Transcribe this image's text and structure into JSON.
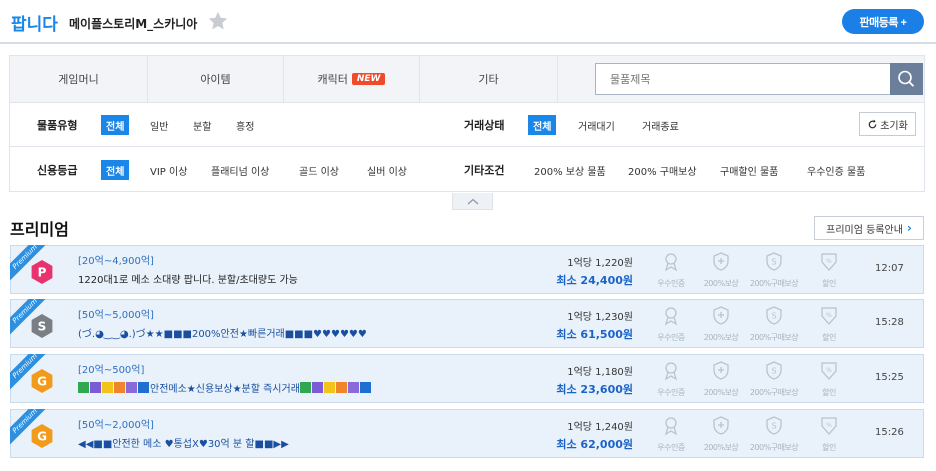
{
  "header": {
    "sell_label": "팝니다",
    "game_name": "메이플스토리M_스카니아",
    "register_button": "판매등록 +"
  },
  "tabs": [
    {
      "label": "게임머니"
    },
    {
      "label": "아이템"
    },
    {
      "label": "캐릭터",
      "badge": "NEW"
    },
    {
      "label": "기타"
    }
  ],
  "search": {
    "placeholder": "물품제목"
  },
  "filters": {
    "product_type": {
      "label": "물품유형",
      "options": [
        "전체",
        "일반",
        "분할",
        "흥정"
      ],
      "selected": "전체"
    },
    "trade_status": {
      "label": "거래상태",
      "options": [
        "전체",
        "거래대기",
        "거래종료"
      ],
      "selected": "전체"
    },
    "reset_label": "초기화",
    "credit": {
      "label": "신용등급",
      "options": [
        "전체",
        "VIP 이상",
        "플래티넘 이상",
        "골드 이상",
        "실버 이상"
      ],
      "selected": "전체"
    },
    "other": {
      "label": "기타조건",
      "options": [
        "200% 보상 물품",
        "200% 구매보상",
        "구매할인 물품",
        "우수인증 물품"
      ]
    }
  },
  "premium": {
    "title": "프리미엄",
    "guide_button": "프리미엄 등록안내",
    "ribbon_label": "Premium",
    "cert_labels": [
      "우수인증",
      "200%보상",
      "200%구매보상",
      "할인"
    ],
    "listings": [
      {
        "grade": "P",
        "grade_color": "#e8336e",
        "range": "[20억~4,900억]",
        "title": "1220대1로 메소 소대량 팝니다. 분할/초대량도 가능",
        "unit_price": "1억당 1,220원",
        "min_price": "최소 24,400원",
        "time": "12:07"
      },
      {
        "grade": "S",
        "grade_color": "#7a7f86",
        "range": "[50억~5,000억]",
        "title": "(づ.◕‿‿◕.)づ★★■■■200%안전★빠른거래■■■♥♥♥♥♥♥",
        "unit_price": "1억당 1,230원",
        "min_price": "최소 61,500원",
        "time": "15:28"
      },
      {
        "grade": "G",
        "grade_color": "#f29a1a",
        "range": "[20억~500억]",
        "title_before": "안전메소★신용보상★분할 즉시거래",
        "unit_price": "1억당 1,180원",
        "min_price": "최소 23,600원",
        "time": "15:25"
      },
      {
        "grade": "G",
        "grade_color": "#f29a1a",
        "range": "[50억~2,000억]",
        "title": "◀◀■■안전한 메소 ♥통섭X♥30억 분 할■■▶▶",
        "unit_price": "1억당 1,240원",
        "min_price": "최소 62,000원",
        "time": "15:26"
      }
    ]
  },
  "colors": {
    "accent": "#1a86e8",
    "new_badge": "#f04a2a",
    "row_bg": "#e9f2fb"
  }
}
